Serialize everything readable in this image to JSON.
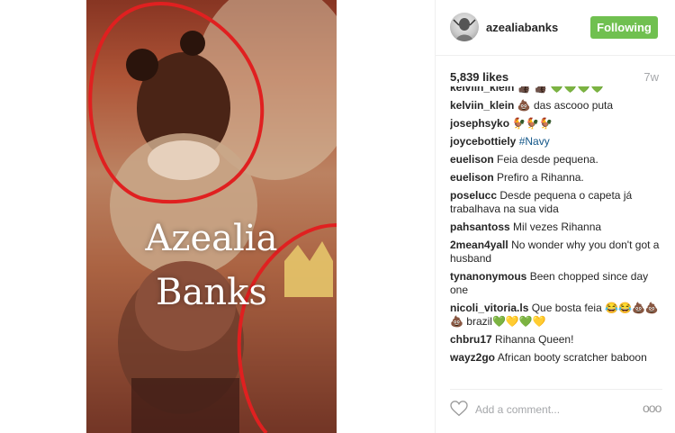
{
  "post": {
    "overlay_line1": "Azealia",
    "overlay_line2": "Banks",
    "accent_red": "#e02020"
  },
  "header": {
    "username": "azealiabanks",
    "follow_label": "Following",
    "follow_color": "#70c050"
  },
  "stats": {
    "likes": "5,839 likes",
    "age": "7w"
  },
  "comments": [
    {
      "user": "kelviin_klein",
      "text": "👍🏿 👍🏿 💚💚💚💚"
    },
    {
      "user": "kelviin_klein",
      "text": "💩 das ascooo puta"
    },
    {
      "user": "josephsyko",
      "text": "🐓🐓🐓"
    },
    {
      "user": "joycebottiely",
      "text": "#Navy"
    },
    {
      "user": "euelison",
      "text": "Feia desde pequena."
    },
    {
      "user": "euelison",
      "text": "Prefiro a Rihanna."
    },
    {
      "user": "poselucc",
      "text": "Desde pequena o capeta já trabalhava na sua vida"
    },
    {
      "user": "pahsantoss",
      "text": "Mil vezes Rihanna"
    },
    {
      "user": "2mean4yall",
      "text": "No wonder why you don't got a husband"
    },
    {
      "user": "tynanonymous",
      "text": "Been chopped since day one"
    },
    {
      "user": "nicoli_vitoria.ls",
      "text": "Que bosta feia 😂😂💩💩💩 brazil💚💛💚💛"
    },
    {
      "user": "chbru17",
      "text": "Rihanna Queen!"
    },
    {
      "user": "wayz2go",
      "text": "African booty scratcher baboon"
    }
  ],
  "footer": {
    "comment_placeholder": "Add a comment...",
    "more_label": "ooo"
  }
}
